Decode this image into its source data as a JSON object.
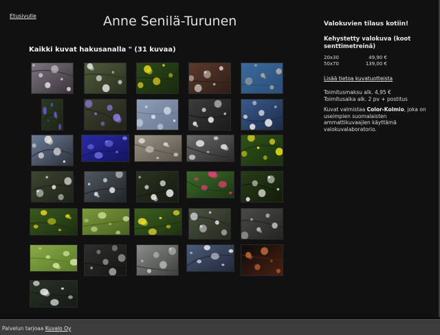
{
  "header": {
    "home_link": "Etusivulle",
    "title": "Anne Senilä-Turunen",
    "search_heading": "Kaikki kuvat hakusanalla \" (31 kuvaa)"
  },
  "sidebar": {
    "title": "Valokuvien tilaus kotiin!",
    "product_title": "Kehystetty valokuva (koot senttimetreinä)",
    "prices": [
      {
        "size": "20x30",
        "price": "49,90 €"
      },
      {
        "size": "50x70",
        "price": "139,00 €"
      }
    ],
    "more_info_link": "Lisää tietoa kuvatuotteista",
    "shipping_fee": "Toimitusmaksu alk. 4,95 €",
    "delivery_time": "Toimitusaika alk. 2 pv + postitus",
    "maker_prefix": "Kuvat valmistaa ",
    "maker_name": "Color-Kolmio",
    "maker_suffix": ", joka on useimpien suomalaisten ammattikuvaajien käyttämä valokuvalaboratorio."
  },
  "footer": {
    "prefix": "Palvelun tarjoaa ",
    "link": "Kuvalo Oy"
  },
  "thumbnails": [
    {
      "name": "blossom-branch-photo",
      "palette": [
        "#7a7580",
        "#e8dce2",
        "#3a3338"
      ]
    },
    {
      "name": "white-blossoms-photo",
      "palette": [
        "#4f5c3c",
        "#e6e2e4",
        "#2a3020"
      ]
    },
    {
      "name": "yellow-flowers-photo",
      "palette": [
        "#2c4a18",
        "#e8d420",
        "#182a0e"
      ]
    },
    {
      "name": "birdhouse-photo",
      "palette": [
        "#5a3a2c",
        "#dcd6d2",
        "#2e1e18"
      ]
    },
    {
      "name": "bare-branches-sky-photo",
      "palette": [
        "#3a6a9c",
        "#b8b0a0",
        "#2a4e78"
      ]
    },
    {
      "name": "blue-wildflower-photo",
      "palette": [
        "#2a3a22",
        "#6a5ae0",
        "#1c2416"
      ]
    },
    {
      "name": "blue-anemones-photo",
      "palette": [
        "#3e4030",
        "#8c7ee0",
        "#22241a"
      ]
    },
    {
      "name": "frosty-twigs-photo",
      "palette": [
        "#8e9eb8",
        "#dde4ee",
        "#6a7890"
      ]
    },
    {
      "name": "white-flowers-bw-photo",
      "palette": [
        "#3c3c3c",
        "#f0f0f0",
        "#1a1a1a"
      ]
    },
    {
      "name": "white-blossoms-blue-photo",
      "palette": [
        "#3a5a8a",
        "#f2f0f0",
        "#1c2c48"
      ]
    },
    {
      "name": "blossoms-against-sky-photo",
      "palette": [
        "#6a7c98",
        "#e8e4e2",
        "#2c3038"
      ]
    },
    {
      "name": "blue-flower-closeup-photo",
      "palette": [
        "#2a2aa8",
        "#7a7af0",
        "#14145c"
      ]
    },
    {
      "name": "frost-plant-photo",
      "palette": [
        "#9a9488",
        "#e0dcd2",
        "#585248"
      ]
    },
    {
      "name": "bw-branches-photo",
      "palette": [
        "#6a6a6a",
        "#e6e6e6",
        "#2a2a2a"
      ]
    },
    {
      "name": "yellow-blooms-photo",
      "palette": [
        "#2e5218",
        "#f0e020",
        "#1a3010"
      ]
    },
    {
      "name": "blossom-twigs-dark-photo",
      "palette": [
        "#3c4630",
        "#ece6e8",
        "#1e2218"
      ]
    },
    {
      "name": "apple-blossoms-photo",
      "palette": [
        "#505860",
        "#ece8ea",
        "#202428"
      ]
    },
    {
      "name": "white-blossom-cluster-photo",
      "palette": [
        "#2a3320",
        "#f0eef0",
        "#151a10"
      ]
    },
    {
      "name": "bleeding-heart-photo",
      "palette": [
        "#3c6a2a",
        "#e8407a",
        "#1e3614"
      ]
    },
    {
      "name": "white-rose-photo",
      "palette": [
        "#283c18",
        "#f4f4f0",
        "#121c0a"
      ]
    },
    {
      "name": "yellow-wildflowers-photo",
      "palette": [
        "#3a5a20",
        "#e8d818",
        "#1c2e0e"
      ]
    },
    {
      "name": "grass-blades-photo",
      "palette": [
        "#7a9a3c",
        "#c8d890",
        "#4a6220"
      ]
    },
    {
      "name": "buttercups-photo",
      "palette": [
        "#3c6020",
        "#f0e030",
        "#1e3210"
      ]
    },
    {
      "name": "pale-blossoms-photo",
      "palette": [
        "#4c5440",
        "#e8e2ec",
        "#24281e"
      ]
    },
    {
      "name": "bokeh-blossom-photo",
      "palette": [
        "#4a4a48",
        "#c8c4c0",
        "#242422"
      ]
    },
    {
      "name": "meadow-grass-photo",
      "palette": [
        "#8aaa48",
        "#d8e8a0",
        "#5a7a28"
      ]
    },
    {
      "name": "bokeh-dark-photo",
      "palette": [
        "#2e2e2c",
        "#a8a8a0",
        "#141412"
      ]
    },
    {
      "name": "lake-landscape-photo",
      "palette": [
        "#8a8c8a",
        "#c8ccc8",
        "#3c403c"
      ]
    },
    {
      "name": "white-blossom-sky-photo",
      "palette": [
        "#4a5c78",
        "#eae8ec",
        "#22283a"
      ]
    },
    {
      "name": "brick-window-photo",
      "palette": [
        "#0c0c0c",
        "#c06838",
        "#4a2010"
      ]
    },
    {
      "name": "cherry-blossoms-photo",
      "palette": [
        "#2a3428",
        "#ece8ec",
        "#141a14"
      ]
    }
  ]
}
